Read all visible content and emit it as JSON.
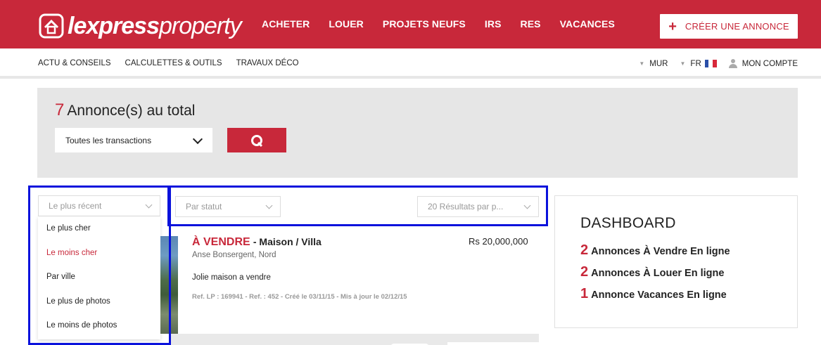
{
  "header": {
    "logo_bold": "lexpress",
    "logo_light": "property",
    "nav": [
      "ACHETER",
      "LOUER",
      "PROJETS NEUFS",
      "IRS",
      "RES",
      "VACANCES"
    ],
    "cta_label": "CRÉER UNE ANNONCE"
  },
  "subnav": {
    "links": [
      "ACTU & CONSEILS",
      "CALCULETTES & OUTILS",
      "TRAVAUX DÉCO"
    ],
    "currency": "MUR",
    "language": "FR",
    "account": "MON COMPTE"
  },
  "search": {
    "total_count": "7",
    "total_label": "Annonce(s) au total",
    "transaction_selected": "Toutes les transactions"
  },
  "sort": {
    "selected": "Le plus récent",
    "options": [
      "Le plus cher",
      "Le moins cher",
      "Par ville",
      "Le plus de photos",
      "Le moins de photos"
    ],
    "highlighted_option": "Le moins cher"
  },
  "filters": {
    "status": "Par statut",
    "results_per_page": "20 Résultats par p..."
  },
  "listing": {
    "badge": "À VENDRE",
    "type": "- Maison / Villa",
    "price": "Rs 20,000,000",
    "location": "Anse Bonsergent, Nord",
    "description": "Jolie maison a vendre",
    "ref": "Ref. LP : 169941 - Ref. : 452 - Créé le 03/11/15 - Mis à jour le 02/12/15"
  },
  "dashboard": {
    "title": "DASHBOARD",
    "lines": [
      {
        "count": "2",
        "label": "Annonces À Vendre En ligne"
      },
      {
        "count": "2",
        "label": "Annonces À Louer En ligne"
      },
      {
        "count": "1",
        "label": "Annonce Vacances En ligne"
      }
    ]
  },
  "colors": {
    "brand_red": "#c8283a",
    "highlight_blue": "#0a12dc"
  }
}
